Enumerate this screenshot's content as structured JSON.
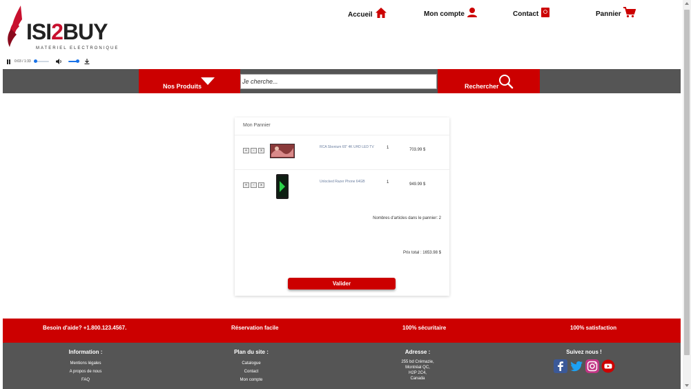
{
  "brand": {
    "name_black": "ISI",
    "name_red": "2",
    "name_black2": "BUY",
    "tagline": "MATERIEL ELECTRONIQUE"
  },
  "audio_player": {
    "time": "0:03 / 1:33"
  },
  "nav": {
    "accueil": "Accueil",
    "compte": "Mon compte",
    "contact": "Contact",
    "panier": "Pannier"
  },
  "search": {
    "products_label": "Nos Produits",
    "placeholder": "Je cherche...",
    "button_label": "Rechercher"
  },
  "cart": {
    "title": "Mon Pannier",
    "qty_buttons": [
      "+",
      "-",
      "x"
    ],
    "items": [
      {
        "name": "RCA Sbonium 65\" 4K UHD LED TV",
        "qty": "1",
        "price": "703.99 $"
      },
      {
        "name": "Unlocked Razer Phone 64GB",
        "qty": "1",
        "price": "949.99 $"
      }
    ],
    "count_text": "Nombres d'articles dans le pannier: 2",
    "total_text": "Prix total : 1653.98 $",
    "validate_label": "Valider"
  },
  "footer": {
    "banner": [
      "Besoin d'aide? +1.800.123.4567.",
      "Réservation facile",
      "100% sécuritaire",
      "100% satisfaction"
    ],
    "information": {
      "title": "Information :",
      "links": [
        "Mentions légales",
        "A propos de nous",
        "FAQ"
      ]
    },
    "plan": {
      "title": "Plan du site :",
      "links": [
        "Catalogue",
        "Contact",
        "Mon compte"
      ]
    },
    "adresse": {
      "title": "Adresse :",
      "lines": [
        "255 bd Crémazie,",
        "Montréal QC,",
        "H2P 2C4,",
        "Canada"
      ]
    },
    "suivez": {
      "title": "Suivez nous !",
      "icons": [
        "facebook-icon",
        "twitter-icon",
        "instagram-icon",
        "youtube-icon"
      ]
    }
  },
  "colors": {
    "brand_red": "#cc0000",
    "bar_grey": "#555555"
  }
}
